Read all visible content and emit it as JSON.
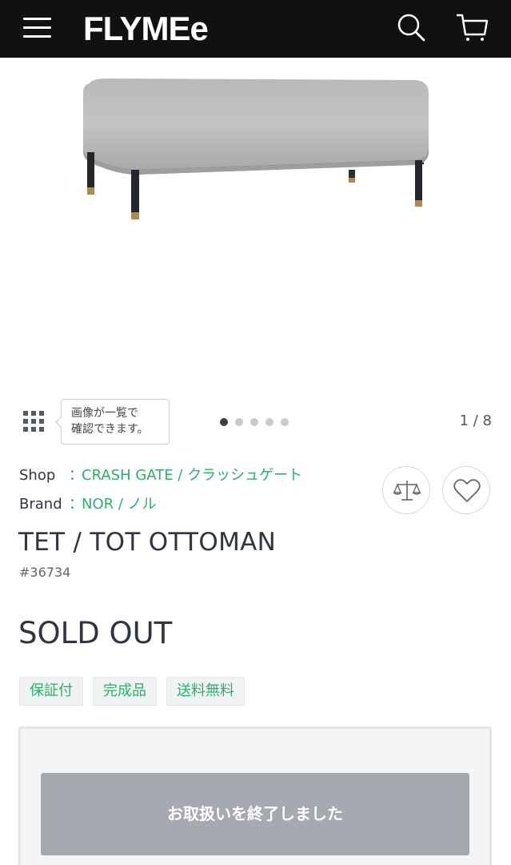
{
  "header": {
    "logo_text": "FLYMEe",
    "menu_icon": "hamburger-menu-icon",
    "search_icon": "search-icon",
    "cart_icon": "cart-icon"
  },
  "gallery": {
    "image_subject": "gray upholstered ottoman on black metal legs",
    "tooltip_line1": "画像が一覧で",
    "tooltip_line2": "確認できます。",
    "counter": "1 / 8",
    "dots": 5,
    "active_dot": 1
  },
  "product": {
    "shop_label": "Shop",
    "shop_sep": "：",
    "shop_value": "CRASH GATE / クラッシュゲート",
    "brand_label": "Brand",
    "brand_sep": "：",
    "brand_value": "NOR / ノル",
    "title": "TET / TOT OTTOMAN",
    "code": "#36734",
    "status": "SOLD OUT",
    "tags": [
      "保証付",
      "完成品",
      "送料無料"
    ],
    "ended_button": "お取扱いを終了しました"
  },
  "colors": {
    "header_bg": "#111111",
    "accent_green": "#2fae6b",
    "disabled_button": "#a7a9b0"
  }
}
